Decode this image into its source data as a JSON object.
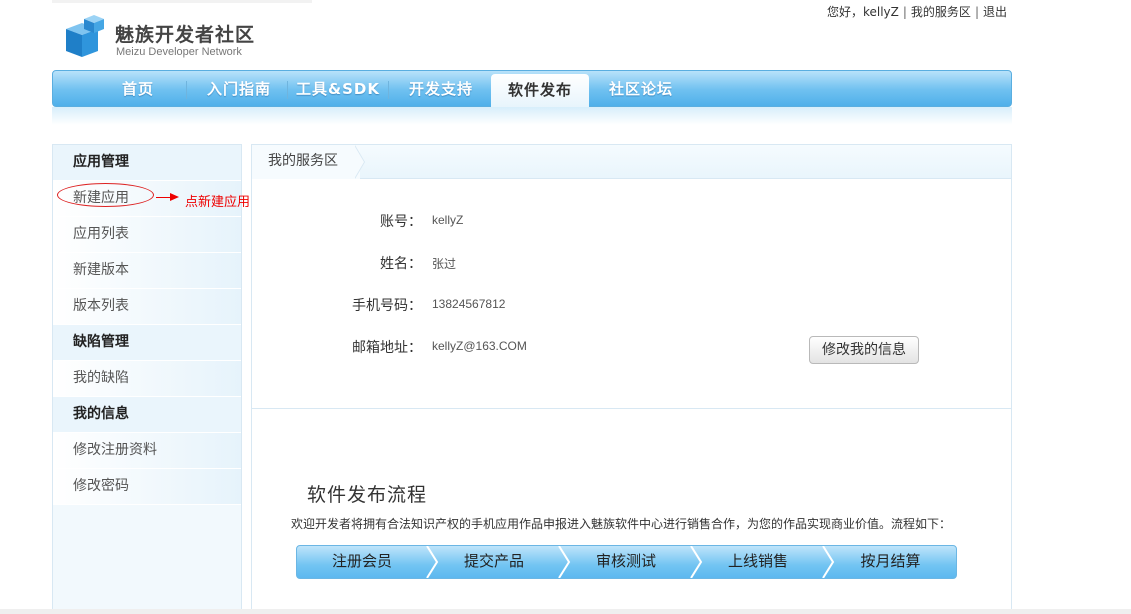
{
  "header": {
    "logo_cn": "魅族开发者社区",
    "logo_en": "Meizu Developer Network",
    "greeting": "您好，kellyZ",
    "my_service": "我的服务区",
    "logout": "退出"
  },
  "nav": {
    "items": [
      "首页",
      "入门指南",
      "工具&SDK",
      "开发支持",
      "软件发布",
      "社区论坛"
    ],
    "active": "软件发布"
  },
  "sidebar": {
    "items": [
      {
        "label": "应用管理",
        "type": "head"
      },
      {
        "label": "新建应用",
        "type": "item"
      },
      {
        "label": "应用列表",
        "type": "item"
      },
      {
        "label": "新建版本",
        "type": "item"
      },
      {
        "label": "版本列表",
        "type": "item"
      },
      {
        "label": "缺陷管理",
        "type": "head"
      },
      {
        "label": "我的缺陷",
        "type": "item"
      },
      {
        "label": "我的信息",
        "type": "head"
      },
      {
        "label": "修改注册资料",
        "type": "item"
      },
      {
        "label": "修改密码",
        "type": "item"
      }
    ]
  },
  "annotation": {
    "text": "点新建应用",
    "color": "#e00000"
  },
  "main": {
    "breadcrumb": "我的服务区",
    "fields": [
      {
        "label": "账号：",
        "value": "kellyZ"
      },
      {
        "label": "姓名：",
        "value": "张过"
      },
      {
        "label": "手机号码：",
        "value": "13824567812"
      },
      {
        "label": "邮箱地址：",
        "value": "kellyZ@163.COM"
      }
    ],
    "edit_button": "修改我的信息",
    "flow_title": "软件发布流程",
    "flow_desc": "欢迎开发者将拥有合法知识产权的手机应用作品申报进入魅族软件中心进行销售合作，为您的作品实现商业价值。流程如下：",
    "flow_steps": [
      "注册会员",
      "提交产品",
      "审核测试",
      "上线销售",
      "按月结算"
    ]
  },
  "colors": {
    "nav_blue": "#5db8ef",
    "sidebar_bg": "#f2f9fd",
    "border": "#d8e8f3"
  }
}
